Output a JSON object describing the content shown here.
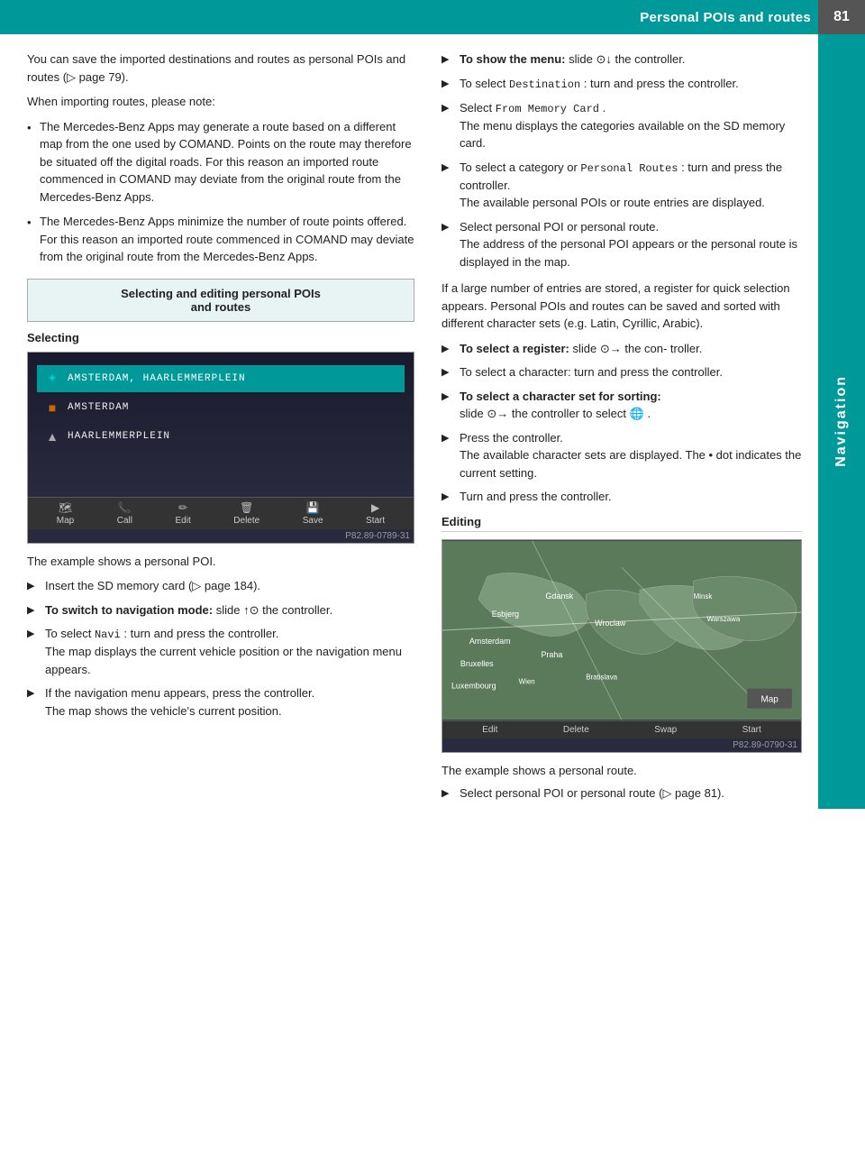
{
  "header": {
    "title": "Personal POIs and routes",
    "page_number": "81",
    "nav_label": "Navigation"
  },
  "left_column": {
    "intro_text": "You can save the imported destinations and routes as personal POIs and routes (▷ page 79).",
    "note_label": "When importing routes, please note:",
    "bullets": [
      "The Mercedes-Benz Apps may generate a route based on a different map from the one used by COMAND. Points on the route may therefore be situated off the digital roads. For this reason an imported route commenced in COMAND may deviate from the original route from the Mercedes-Benz Apps.",
      "The Mercedes-Benz Apps minimize the number of route points offered. For this reason an imported route commenced in COMAND may deviate from the original route from the Mercedes-Benz Apps."
    ],
    "section_box": {
      "line1": "Selecting and editing personal POIs",
      "line2": "and routes"
    },
    "selecting_label": "Selecting",
    "nav_screenshot": {
      "items": [
        {
          "type": "star",
          "text": "AMSTERDAM, HAARLEMMERPLEIN",
          "selected": true
        },
        {
          "type": "dot",
          "text": "AMSTERDAM",
          "selected": false
        },
        {
          "type": "pin",
          "text": "HAARLEMMERPLEIN",
          "selected": false
        }
      ],
      "toolbar_buttons": [
        "Map",
        "Call",
        "Edit",
        "Delete",
        "Save",
        "Start"
      ],
      "caption": "P82.89-0789-31"
    },
    "example_text": "The example shows a personal POI.",
    "instruction1": "Insert the SD memory card (▷ page 184).",
    "instruction2_label": "To switch to navigation mode:",
    "instruction2_text": "slide ↑⊙ the controller.",
    "instruction3_text": "To select",
    "instruction3_code": "Navi",
    "instruction3_rest": ": turn and press the controller.",
    "instruction3_sub": "The map displays the current vehicle position or the navigation menu appears.",
    "instruction4": "If the navigation menu appears, press the controller.",
    "instruction4_sub": "The map shows the vehicle's current position."
  },
  "right_column": {
    "instruction_show_menu_label": "To show the menu:",
    "instruction_show_menu_text": "slide ⊙↓ the controller.",
    "instruction_dest_text": "To select",
    "instruction_dest_code": "Destination",
    "instruction_dest_rest": ": turn and press the controller.",
    "instruction_from_mem": "Select",
    "instruction_from_mem_code": "From Memory Card",
    "instruction_from_mem_rest": ".",
    "instruction_from_mem_sub": "The menu displays the categories available on the SD memory card.",
    "instruction_category_text": "To select a category or",
    "instruction_category_code": "Personal Routes",
    "instruction_category_rest": ": turn and press the controller.",
    "instruction_category_sub": "The available personal POIs or route entries are displayed.",
    "instruction_select_text": "Select personal POI or personal route.",
    "instruction_select_sub": "The address of the personal POI appears or the personal route is displayed in the map.",
    "register_note": "If a large number of entries are stored, a register for quick selection appears. Personal POIs and routes can be saved and sorted with different character sets (e.g. Latin, Cyrillic, Arabic).",
    "instruction_register_label": "To select a register:",
    "instruction_register_text": "slide ⊙→ the con- troller.",
    "instruction_char_text": "To select a character: turn and press the controller.",
    "instruction_charset_label": "To select a character set for sorting:",
    "instruction_charset_text": "slide ⊙→ the controller to select",
    "instruction_charset_icon": "🌐",
    "instruction_charset_rest": ".",
    "instruction_press": "Press the controller.",
    "instruction_press_sub": "The available character sets are displayed. The • dot indicates the current setting.",
    "instruction_turn": "Turn and press the controller.",
    "editing_label": "Editing",
    "map_screenshot": {
      "caption": "P82.89-0790-31",
      "toolbar_buttons": [
        "Edit",
        "Delete",
        "Swap",
        "Start"
      ],
      "map_label": "Map"
    },
    "example_route_text": "The example shows a personal route.",
    "instruction_select_poi": "Select personal POI or personal route (▷ page 81)."
  }
}
